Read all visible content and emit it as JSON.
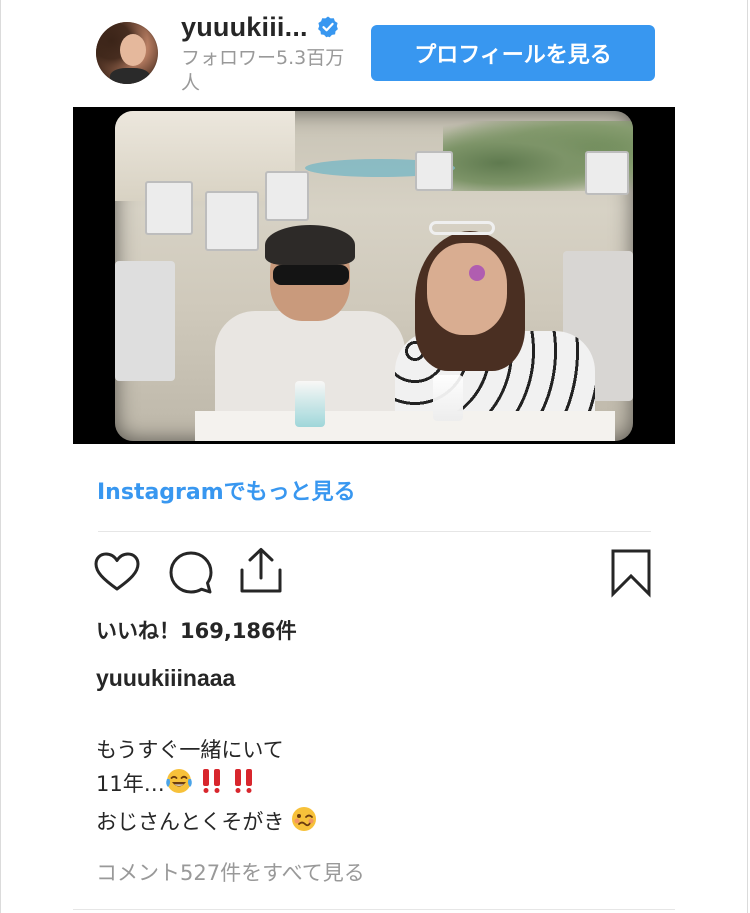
{
  "header": {
    "username": "yuuukiii...",
    "followers": "フォロワー5.3百万人",
    "profile_button": "プロフィールを見る"
  },
  "icons": {
    "verified": "verified-badge-icon",
    "like": "heart-icon",
    "comment": "comment-bubble-icon",
    "share": "share-icon",
    "save": "bookmark-icon"
  },
  "post": {
    "more_link": "Instagramでもっと見る",
    "likes": "いいね！169,186件",
    "caption_username": "yuuukiiinaaa",
    "caption_line1": "もうすぐ一緒にいて",
    "caption_line2": "11年…",
    "caption_line3": "おじさんとくそがき",
    "comments_link": "コメント527件をすべて見る"
  },
  "colors": {
    "accent": "#3897f0",
    "text": "#262626",
    "muted": "#999999"
  }
}
